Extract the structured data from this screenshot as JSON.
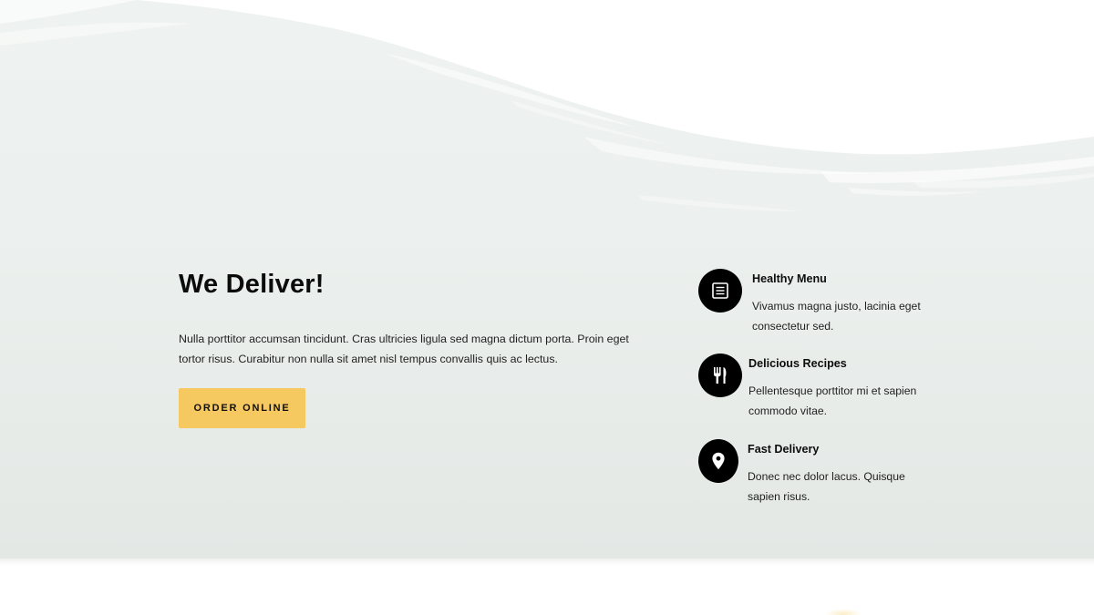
{
  "hero": {
    "title": "We Deliver!",
    "description": "Nulla porttitor accumsan tincidunt. Cras ultricies ligula sed magna dictum porta. Proin eget tortor risus. Curabitur non nulla sit amet nisl tempus convallis quis ac lectus.",
    "button_label": "ORDER ONLINE"
  },
  "features": [
    {
      "icon": "menu-list-icon",
      "title": "Healthy Menu",
      "description": "Vivamus magna justo, lacinia eget consectetur sed."
    },
    {
      "icon": "fork-knife-icon",
      "title": "Delicious Recipes",
      "description": "Pellentesque porttitor mi et sapien commodo vitae."
    },
    {
      "icon": "location-pin-icon",
      "title": "Fast Delivery",
      "description": "Donec nec dolor lacus. Quisque sapien risus."
    }
  ],
  "colors": {
    "background": "#eef2f0",
    "button": "#f6c860",
    "icon_circle": "#000000",
    "text": "#111111"
  }
}
